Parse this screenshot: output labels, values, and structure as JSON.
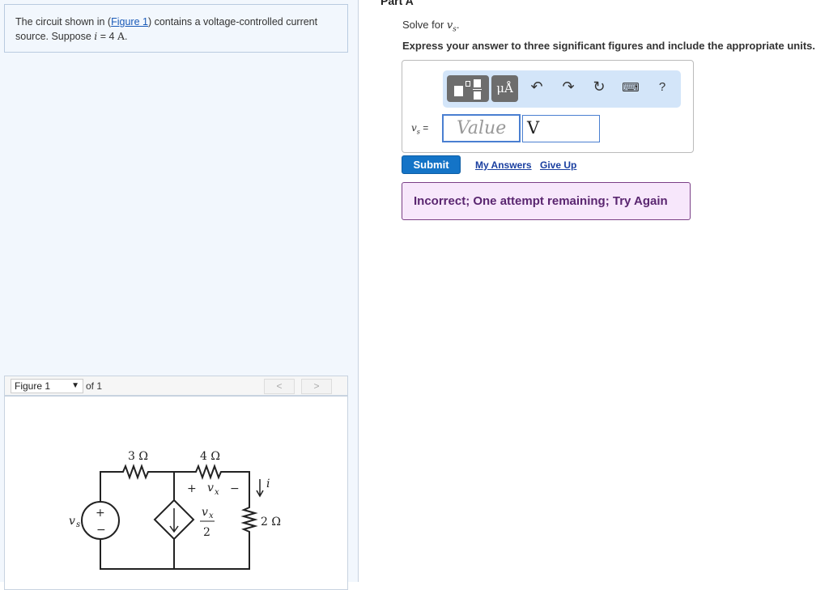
{
  "problem": {
    "text_before": "The circuit shown in (",
    "figure_link": "Figure 1",
    "text_after": ") contains a voltage-controlled current source. Suppose ",
    "var_i": "i",
    "equals": " = 4 ",
    "unit_A": "A",
    "period": "."
  },
  "figure_nav": {
    "selected": "Figure 1",
    "of": "of 1",
    "prev": "<",
    "next": ">"
  },
  "circuit": {
    "r1": "3 Ω",
    "r2": "4 Ω",
    "r3": "2 Ω",
    "vs": "v",
    "vs_sub": "s",
    "plus": "+",
    "minus": "−",
    "vx_plus": "+",
    "vx": "v",
    "vx_sub": "x",
    "vx_minus": "−",
    "ctrl_num": "v",
    "ctrl_num_sub": "x",
    "ctrl_den": "2",
    "i": "i"
  },
  "part": {
    "title": "Part A",
    "solve_prefix": "Solve for ",
    "solve_var": "v",
    "solve_sub": "s",
    "solve_suffix": ".",
    "instruction": "Express your answer to three significant figures and include the appropriate units."
  },
  "answer": {
    "label_var": "v",
    "label_sub": "s",
    "label_eq": " =",
    "value_placeholder": "Value",
    "unit_value": "V",
    "units_button": "μÅ",
    "help": "?"
  },
  "actions": {
    "submit": "Submit",
    "my_answers": "My Answers",
    "give_up": "Give Up"
  },
  "feedback": "Incorrect; One attempt remaining; Try Again"
}
